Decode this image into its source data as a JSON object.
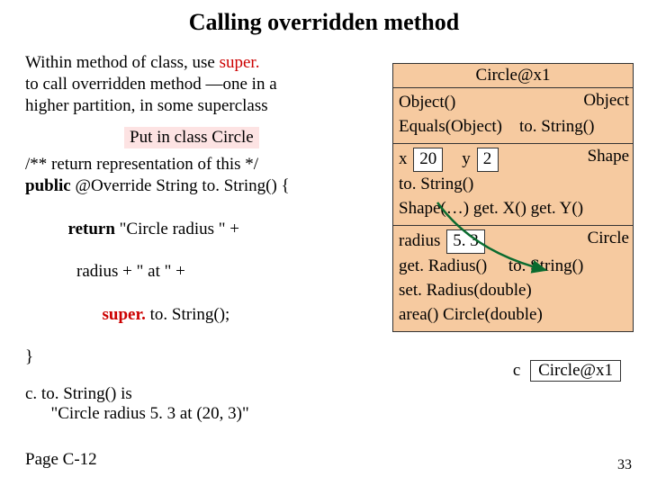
{
  "title": "Calling overridden method",
  "intro": {
    "l1": "Within method of class, use  ",
    "super": "super.",
    "l2": "to call overridden method —one in a",
    "l3": "higher partition, in some superclass"
  },
  "putline": "Put in class Circle",
  "code": {
    "c1": "/** return representation of this */",
    "c2a": "public ",
    "c2b": "@Override String to. String() {",
    "c3a": "    return ",
    "c3b": "\"Circle radius \" +",
    "c4": "            radius + \" at \" +",
    "c5a": "            ",
    "c5b": "super. ",
    "c5c": "to. String();",
    "c6": "}"
  },
  "eval": {
    "e1": "c. to. String()  is",
    "e2": "      \"Circle radius 5. 3 at (20, 3)\""
  },
  "pagec": "Page C-12",
  "slidenum": "33",
  "diagram": {
    "header": "Circle@x1",
    "obj": {
      "label": "Object",
      "r1a": "Object()",
      "r2a": "Equals(Object)",
      "r2b": "to. String()"
    },
    "shape": {
      "label": "Shape",
      "x": "x",
      "xv": "20",
      "y": "y",
      "yv": "2",
      "r1": "to. String()",
      "r2": "Shape(…)  get. X()  get. Y()"
    },
    "circle": {
      "label": "Circle",
      "rad": "radius",
      "radv": "5. 3",
      "r1a": "get. Radius()",
      "r1b": "to. String()",
      "r2": "set. Radius(double)",
      "r3": "area()  Circle(double)"
    }
  },
  "cvar": {
    "label": "c",
    "val": "Circle@x1"
  }
}
